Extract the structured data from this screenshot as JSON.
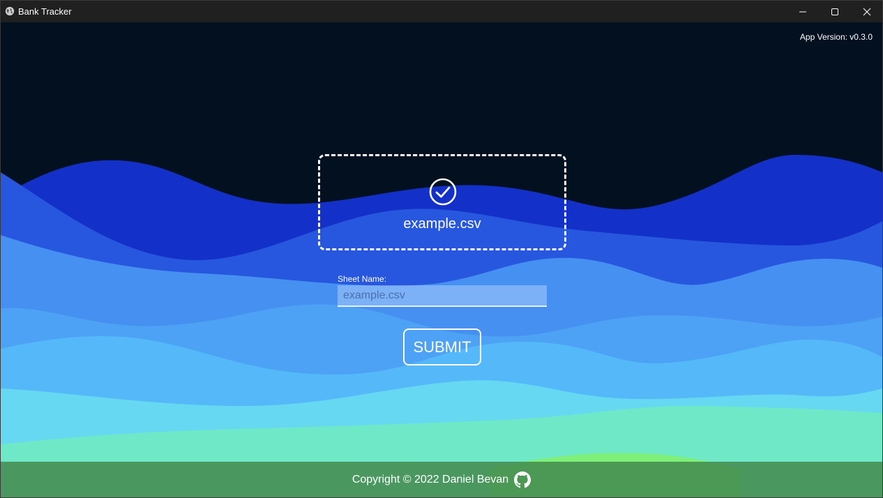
{
  "window": {
    "title": "Bank Tracker",
    "icon": "globe-icon",
    "controls": [
      "minimize-icon",
      "maximize-icon",
      "close-icon"
    ]
  },
  "header": {
    "app_version": "App Version: v0.3.0"
  },
  "dropzone": {
    "status_icon": "check-circle-icon",
    "file_name": "example.csv"
  },
  "form": {
    "sheet_label": "Sheet Name:",
    "sheet_placeholder": "example.csv",
    "sheet_value": "",
    "submit_label": "SUBMIT"
  },
  "footer": {
    "copyright": "Copyright © 2022 Daniel Bevan",
    "link_icon": "github-icon"
  },
  "colors": {
    "background": "#03101f",
    "titlebar": "#202020",
    "wave_dark_blue": "#1330c8",
    "wave_blue": "#2657de",
    "wave_mid_blue": "#4590f0",
    "wave_light_blue": "#55b8f8",
    "wave_cyan": "#66d8f2",
    "wave_teal": "#6fe8c8",
    "footer_green": "#468c50"
  }
}
